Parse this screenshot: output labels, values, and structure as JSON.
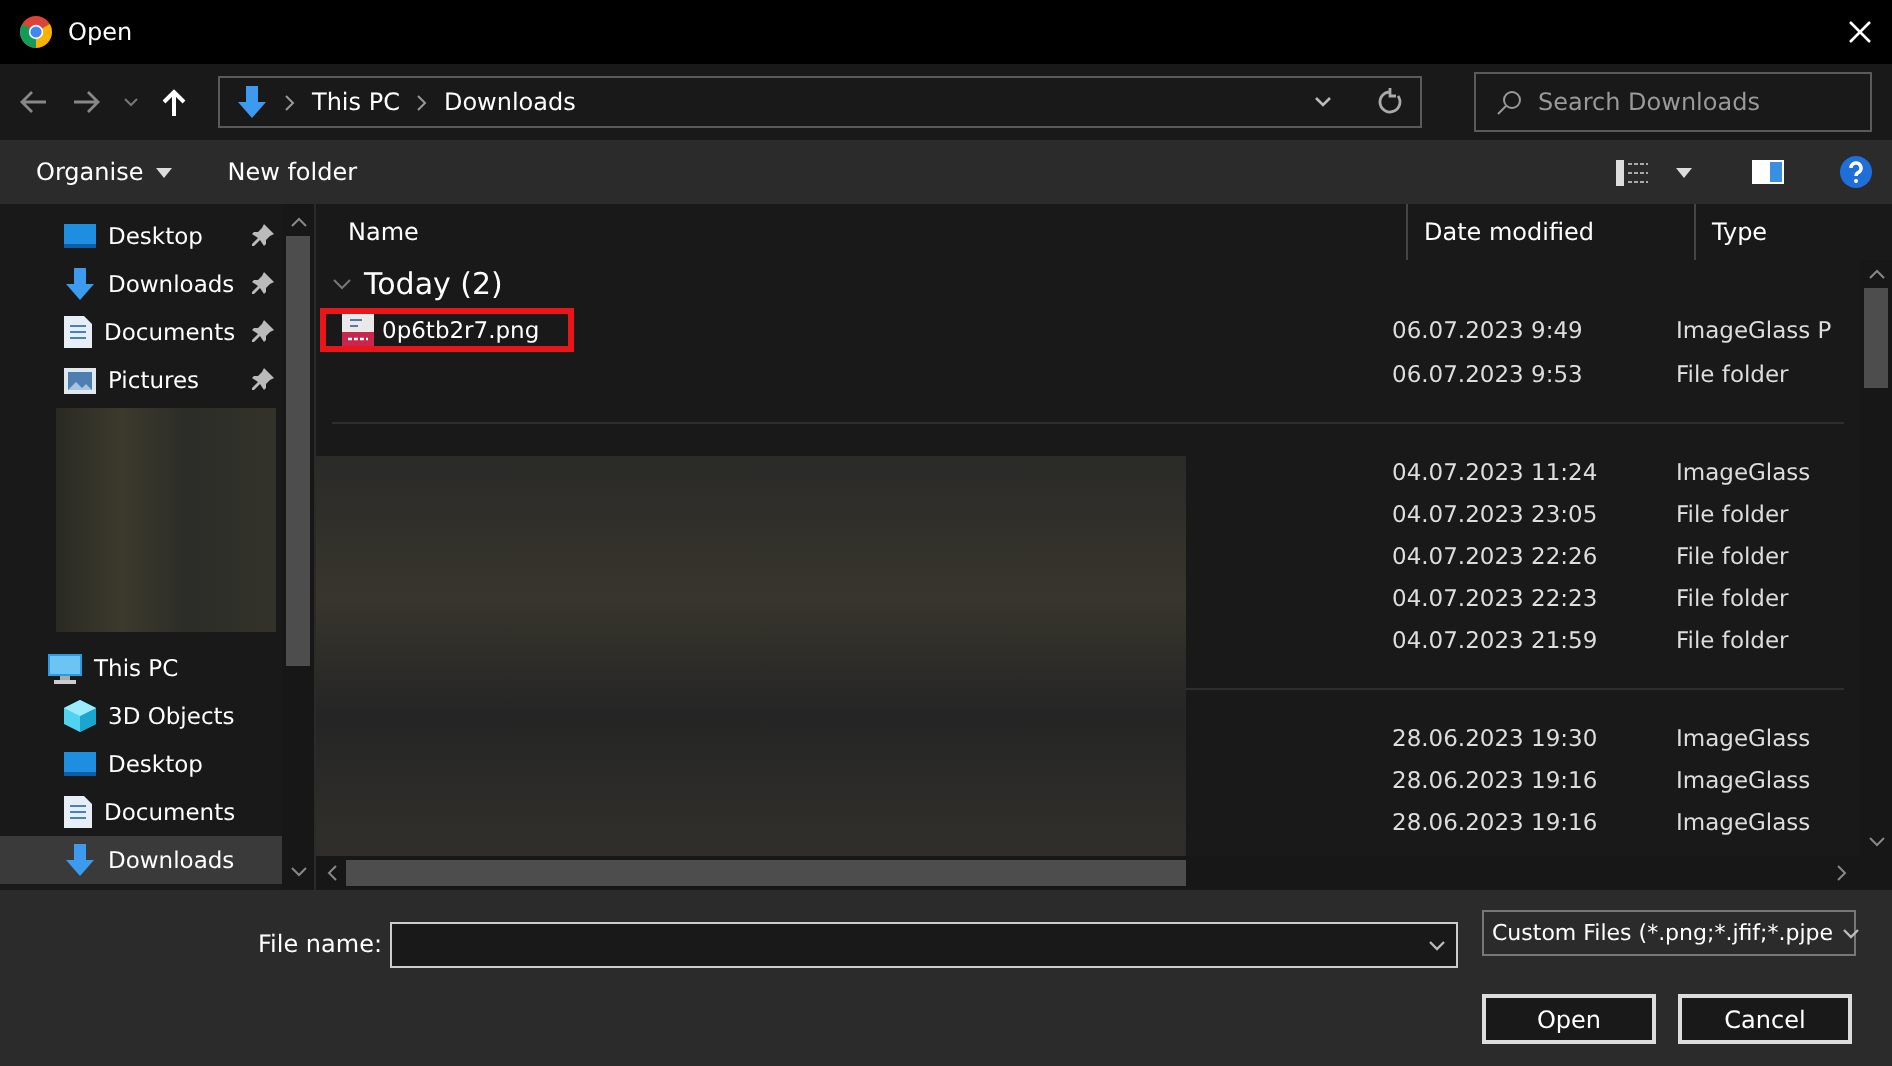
{
  "window": {
    "title": "Open"
  },
  "address": {
    "path": [
      "This PC",
      "Downloads"
    ],
    "search_placeholder": "Search Downloads"
  },
  "toolbar": {
    "organise": "Organise",
    "new_folder": "New folder"
  },
  "sidebar": {
    "quick_access": [
      {
        "label": "Desktop",
        "kind": "desktop",
        "pinned": true,
        "selected": false
      },
      {
        "label": "Downloads",
        "kind": "download",
        "pinned": true,
        "selected": false
      },
      {
        "label": "Documents",
        "kind": "document",
        "pinned": true,
        "selected": false
      },
      {
        "label": "Pictures",
        "kind": "picture",
        "pinned": true,
        "selected": false
      }
    ],
    "this_pc": {
      "label": "This PC",
      "children": [
        {
          "label": "3D Objects",
          "kind": "cube",
          "selected": false
        },
        {
          "label": "Desktop",
          "kind": "desktop",
          "selected": false
        },
        {
          "label": "Documents",
          "kind": "document",
          "selected": false
        },
        {
          "label": "Downloads",
          "kind": "download",
          "selected": true
        }
      ]
    }
  },
  "table": {
    "columns": [
      "Name",
      "Date modified",
      "Type"
    ],
    "groups": [
      {
        "header": "Today (2)",
        "expanded": true,
        "rows": [
          {
            "name": "0p6tb2r7.png",
            "highlighted": true,
            "date": "06.07.2023 9:49",
            "type": "ImageGlass P"
          },
          {
            "date": "06.07.2023 9:53",
            "type": "File folder"
          }
        ]
      },
      {
        "rows": [
          {
            "date": "04.07.2023 11:24",
            "type": "ImageGlass"
          },
          {
            "date": "04.07.2023 23:05",
            "type": "File folder"
          },
          {
            "date": "04.07.2023 22:26",
            "type": "File folder"
          },
          {
            "date": "04.07.2023 22:23",
            "type": "File folder"
          },
          {
            "date": "04.07.2023 21:59",
            "type": "File folder"
          }
        ]
      },
      {
        "rows": [
          {
            "date": "28.06.2023 19:30",
            "type": "ImageGlass"
          },
          {
            "date": "28.06.2023 19:16",
            "type": "ImageGlass"
          },
          {
            "date": "28.06.2023 19:16",
            "type": "ImageGlass"
          }
        ]
      }
    ]
  },
  "footer": {
    "file_name_label": "File name:",
    "filter": "Custom Files (*.png;*.jfif;*.pjpe",
    "buttons": [
      "Open",
      "Cancel"
    ]
  }
}
